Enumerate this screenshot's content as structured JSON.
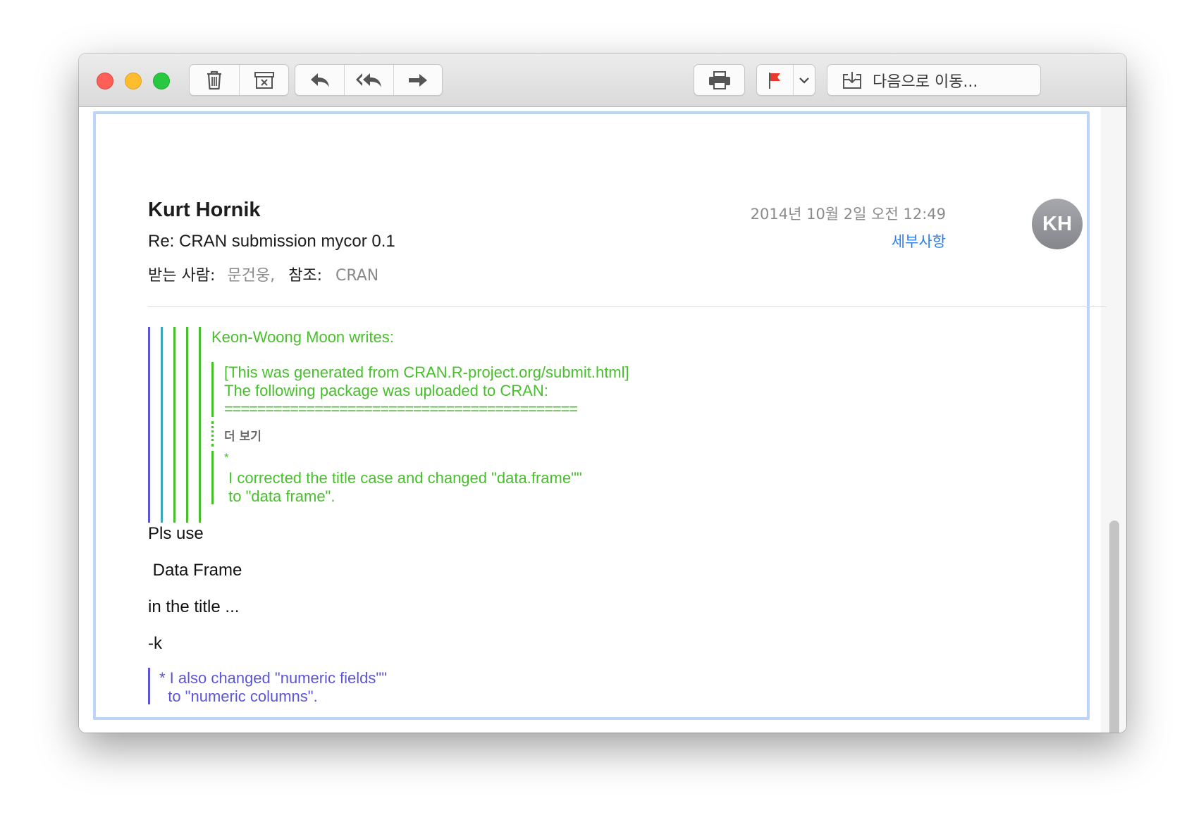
{
  "toolbar": {
    "buttons": [
      "trash-icon",
      "archive-icon",
      "reply-icon",
      "reply-all-icon",
      "forward-icon",
      "print-icon",
      "flag-icon",
      "chevron-down-icon",
      "move-to-icon"
    ],
    "move_label": "다음으로 이동...",
    "flag_color": "#e8392b"
  },
  "header": {
    "sender": "Kurt Hornik",
    "subject": "Re: CRAN submission mycor 0.1",
    "to_label": "받는 사람:",
    "to_value": "문건웅,",
    "cc_label": "참조:",
    "cc_value": "CRAN",
    "date": "2014년 10월 2일 오전 12:49",
    "details_link": "세부사항",
    "avatar_initials": "KH"
  },
  "quote": {
    "attribution": "Keon-Woong Moon writes:",
    "lines": [
      "[This was generated from CRAN.R-project.org/submit.html]",
      "The following package was uploaded to CRAN:",
      "==========================================="
    ],
    "show_more": "더 보기",
    "bullet": "*",
    "correction_lines": [
      " I corrected the title case and changed \"data.frame\"\"",
      " to \"data frame\"."
    ],
    "bar_colors": [
      "#5b56d8",
      "#3aa6b8",
      "#47c02b",
      "#47c02b",
      "#47c02b"
    ]
  },
  "reply": {
    "lines": [
      "Pls use",
      " Data Frame",
      "in the title ...",
      "-k"
    ]
  },
  "trailing_quote": {
    "lines": [
      "* I also changed \"numeric fields\"\"",
      "  to \"numeric columns\"."
    ]
  }
}
